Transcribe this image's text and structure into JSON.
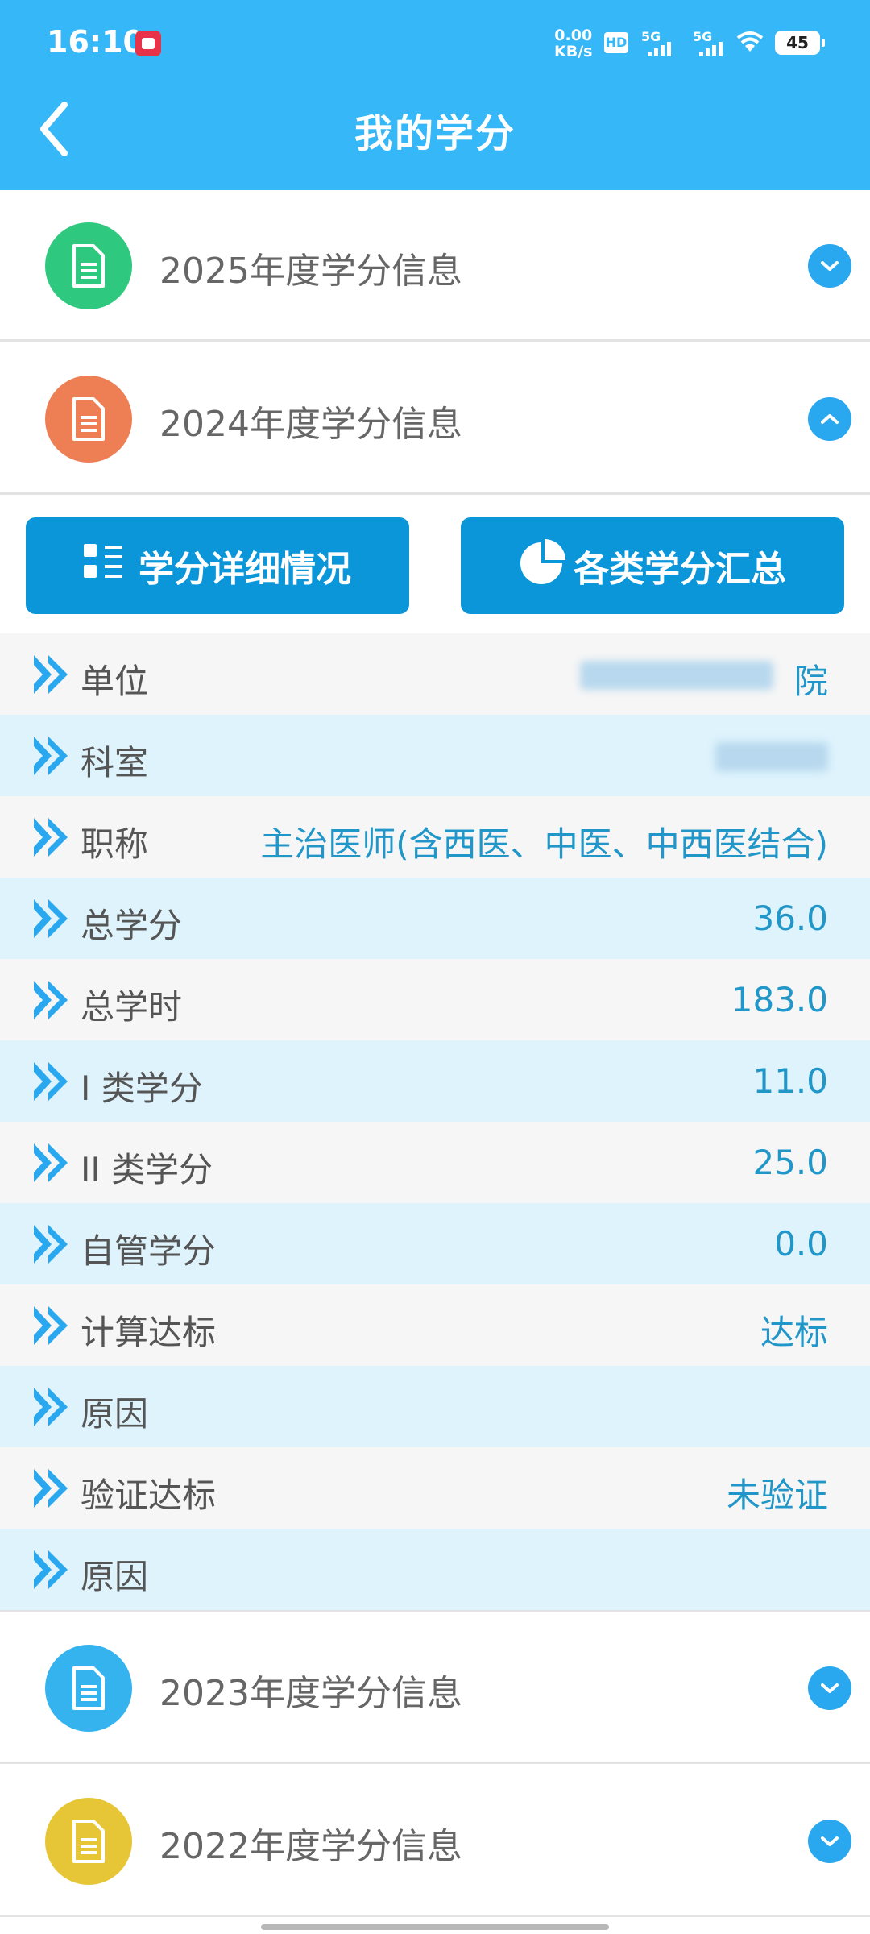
{
  "status_bar": {
    "time": "16:10",
    "net_speed_value": "0.00",
    "net_speed_unit": "KB/s",
    "hd_label": "HD",
    "signal1_label": "5G",
    "signal2_label": "5G",
    "battery": "45"
  },
  "header": {
    "title": "我的学分",
    "background": "#36b7f7"
  },
  "years": [
    {
      "label": "2025年度学分信息",
      "expanded": false,
      "badge_color": "#2ec97e"
    },
    {
      "label": "2024年度学分信息",
      "expanded": true,
      "badge_color": "#ee7f55"
    },
    {
      "label": "2023年度学分信息",
      "expanded": false,
      "badge_color": "#34b3ef"
    },
    {
      "label": "2022年度学分信息",
      "expanded": false,
      "badge_color": "#e6c637"
    }
  ],
  "actions": {
    "detail_label": "学分详细情况",
    "summary_label": "各类学分汇总"
  },
  "details": [
    {
      "label": "单位",
      "value": "院",
      "blurred": true
    },
    {
      "label": "科室",
      "value": "",
      "blurred": true
    },
    {
      "label": "职称",
      "value": "主治医师(含西医、中医、中西医结合)"
    },
    {
      "label": "总学分",
      "value": "36.0"
    },
    {
      "label": "总学时",
      "value": "183.0"
    },
    {
      "label": "I 类学分",
      "value": "11.0"
    },
    {
      "label": "II 类学分",
      "value": "25.0"
    },
    {
      "label": "自管学分",
      "value": "0.0"
    },
    {
      "label": "计算达标",
      "value": "达标"
    },
    {
      "label": "原因",
      "value": ""
    },
    {
      "label": "验证达标",
      "value": "未验证"
    },
    {
      "label": "原因",
      "value": ""
    }
  ],
  "colors": {
    "accent": "#36b7f7",
    "button": "#0b96da",
    "value_text": "#2196c8",
    "row_light": "#f6f6f6",
    "row_blue": "#def3fc"
  }
}
